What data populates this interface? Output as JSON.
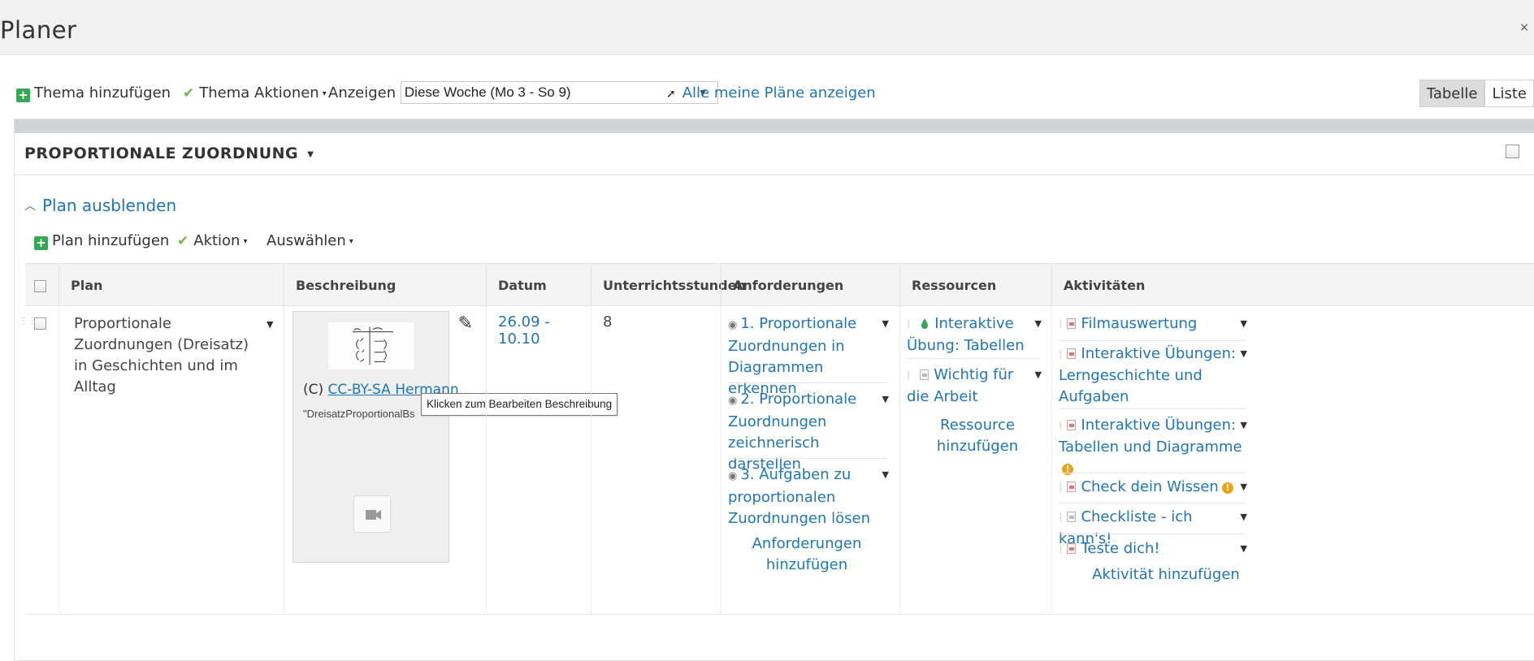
{
  "app": {
    "title": "Planer",
    "close": "×"
  },
  "toolbar": {
    "add_topic": "Thema hinzufügen",
    "topic_actions": "Thema Aktionen",
    "show_label": "Anzeigen",
    "period_select": "Diese Woche (Mo 3 - So 9)",
    "all_plans": "Alle meine Pläne anzeigen",
    "view_table": "Tabelle",
    "view_list": "Liste"
  },
  "topic": {
    "title": "PROPORTIONALE ZUORDNUNG",
    "hide_plan": "Plan ausblenden",
    "add_plan": "Plan hinzufügen",
    "action": "Aktion",
    "select": "Auswählen"
  },
  "table": {
    "headers": {
      "plan": "Plan",
      "description": "Beschreibung",
      "date": "Datum",
      "lessons": "Unterrichtsstunden",
      "requirements": "Anforderungen",
      "resources": "Ressourcen",
      "activities": "Aktivitäten"
    },
    "row": {
      "plan_name": "Proportionale Zuordnungen (Dreisatz) in Geschichten und im Alltag",
      "credit_prefix": "(C) ",
      "credit_link": "CC-BY-SA Hermann",
      "filename": "\"DreisatzProportionalBs",
      "tooltip": "Klicken zum Bearbeiten Beschreibung",
      "date": "26.09 - 10.10",
      "lessons": "8",
      "requirements": [
        "1. Proportionale Zuordnungen in Diagrammen erkennen",
        "2. Proportionale Zuordnungen zeichnerisch darstellen",
        "3. Aufgaben zu proportionalen Zuordnungen lösen"
      ],
      "add_requirements": "Anforderungen hinzufügen",
      "resources": [
        "Interaktive Übung: Tabellen",
        "Wichtig für die Arbeit"
      ],
      "add_resource": "Ressource hinzufügen",
      "activities": [
        "Filmauswertung",
        "Interaktive Übungen: Lerngeschichte und Aufgaben",
        "Interaktive Übungen: Tabellen und Diagramme",
        "Check dein Wissen",
        "Checkliste - ich kann's!",
        "Teste dich!"
      ],
      "add_activity": "Aktivität hinzufügen"
    }
  },
  "colors": {
    "link": "#1f75b6",
    "add_green": "#35a853",
    "warning": "#e8a317",
    "header_bg": "#f4f4f4"
  },
  "icons": [
    "plus-icon",
    "check-icon",
    "pin-icon",
    "edit-icon",
    "video-icon",
    "warning-icon",
    "file-icon",
    "grip-icon",
    "chevron-up-icon",
    "caret-down-icon",
    "target-icon"
  ]
}
